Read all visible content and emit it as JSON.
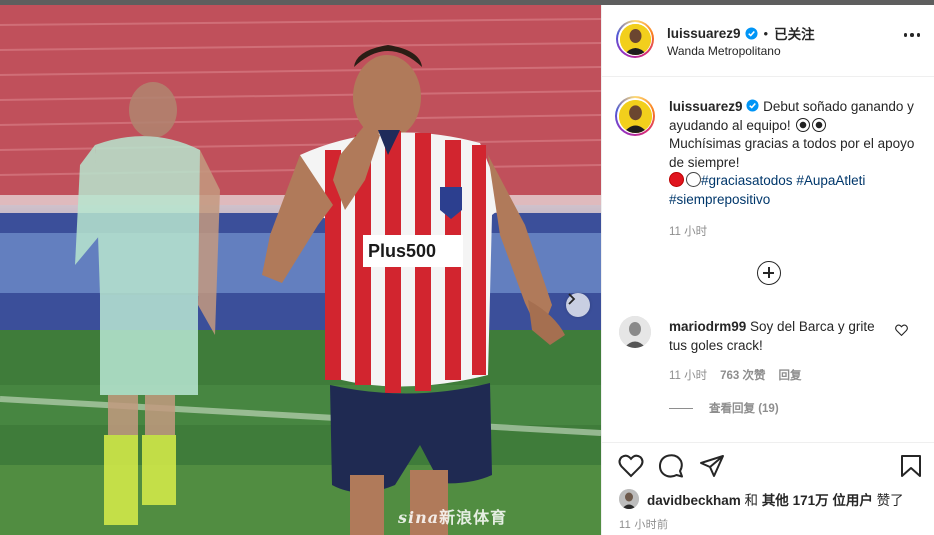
{
  "post": {
    "watermark_brand": "sina",
    "watermark_text": "新浪体育"
  },
  "header": {
    "username": "luissuarez9",
    "separator": "•",
    "follow_label": "已关注",
    "location": "Wanda Metropolitano"
  },
  "caption": {
    "username": "luissuarez9",
    "text_line1": " Debut soñado ganando y ayudando al equipo! ",
    "text_line2": "Muchísimas gracias a todos por el apoyo de siempre!",
    "hashtags": [
      "#graciasatodos",
      "#AupaAtleti",
      "#siemprepositivo"
    ],
    "time": "11 小时"
  },
  "comment": {
    "username": "mariodrm99",
    "text": " Soy del Barca y grite tus goles crack!",
    "time": "11 小时",
    "likes": "763 次赞",
    "reply_label": "回复",
    "view_replies": "查看回复 (19)"
  },
  "likes_line": {
    "user": "davidbeckham",
    "middle": " 和 ",
    "others": "其他 171万 位用户",
    "suffix": " 赞了"
  },
  "post_time": "11 小时前",
  "colors": {
    "accent_link": "#00376b",
    "verified": "#0095f6",
    "secondary_text": "#8e8e8e"
  },
  "icons": [
    "verified-icon",
    "more-options-icon",
    "next-arrow-icon",
    "plus-circle-icon",
    "heart-icon",
    "comment-icon",
    "share-icon",
    "bookmark-icon"
  ]
}
